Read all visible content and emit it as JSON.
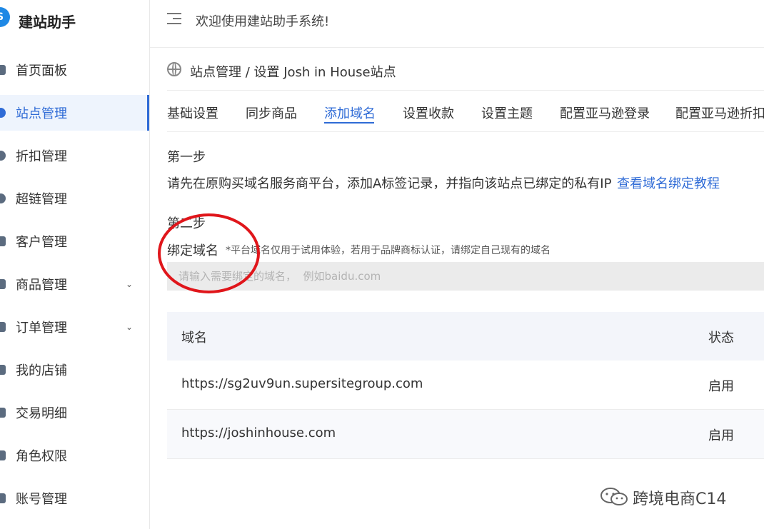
{
  "app": {
    "title": "建站助手",
    "logo_glyph": "S"
  },
  "sidebar": {
    "items": [
      {
        "label": "首页面板",
        "icon": "dashboard-icon",
        "has_chevron": false,
        "active": false
      },
      {
        "label": "站点管理",
        "icon": "globe-icon",
        "has_chevron": false,
        "active": true
      },
      {
        "label": "折扣管理",
        "icon": "discount-icon",
        "has_chevron": false,
        "active": false
      },
      {
        "label": "超链管理",
        "icon": "link-icon",
        "has_chevron": false,
        "active": false
      },
      {
        "label": "客户管理",
        "icon": "user-icon",
        "has_chevron": false,
        "active": false
      },
      {
        "label": "商品管理",
        "icon": "bag-icon",
        "has_chevron": true,
        "active": false
      },
      {
        "label": "订单管理",
        "icon": "order-icon",
        "has_chevron": true,
        "active": false
      },
      {
        "label": "我的店铺",
        "icon": "store-icon",
        "has_chevron": false,
        "active": false
      },
      {
        "label": "交易明细",
        "icon": "transaction-icon",
        "has_chevron": false,
        "active": false
      },
      {
        "label": "角色权限",
        "icon": "role-icon",
        "has_chevron": false,
        "active": false
      },
      {
        "label": "账号管理",
        "icon": "account-icon",
        "has_chevron": false,
        "active": false
      }
    ],
    "chevron_glyph": "⌄"
  },
  "header": {
    "welcome": "欢迎使用建站助手系统!"
  },
  "breadcrumb": {
    "text": "站点管理 / 设置 Josh in House站点"
  },
  "tabs": [
    {
      "label": "基础设置",
      "active": false
    },
    {
      "label": "同步商品",
      "active": false
    },
    {
      "label": "添加域名",
      "active": true
    },
    {
      "label": "设置收款",
      "active": false
    },
    {
      "label": "设置主题",
      "active": false
    },
    {
      "label": "配置亚马逊登录",
      "active": false
    },
    {
      "label": "配置亚马逊折扣",
      "active": false
    }
  ],
  "step1": {
    "title": "第一步",
    "description": "请先在原购买域名服务商平台，添加A标签记录，并指向该站点已绑定的私有IP",
    "link": "查看域名绑定教程"
  },
  "step2": {
    "title": "第二步",
    "bind_label": "绑定域名",
    "note": "*平台域名仅用于试用体验，若用于品牌商标认证，请绑定自己现有的域名",
    "input_placeholder": "请输入需要绑定的域名，  例如baidu.com"
  },
  "table": {
    "columns": [
      "域名",
      "状态"
    ],
    "rows": [
      {
        "domain": "https://sg2uv9un.supersitegroup.com",
        "status": "启用"
      },
      {
        "domain": "https://joshinhouse.com",
        "status": "启用"
      }
    ]
  },
  "colors": {
    "accent": "#2f6bd6",
    "annotation": "#e0161b"
  },
  "watermark": {
    "text": "跨境电商C14"
  }
}
